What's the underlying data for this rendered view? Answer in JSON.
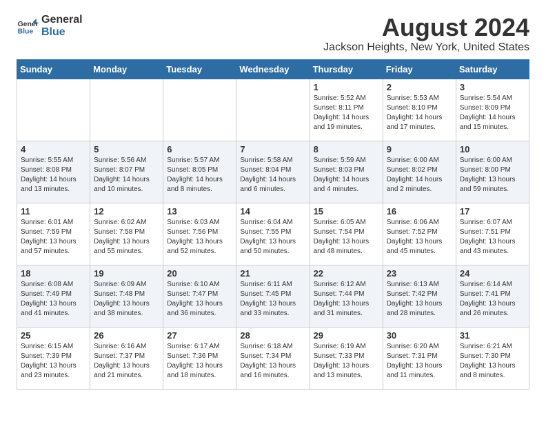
{
  "header": {
    "logo_general": "General",
    "logo_blue": "Blue",
    "month": "August 2024",
    "location": "Jackson Heights, New York, United States"
  },
  "days_of_week": [
    "Sunday",
    "Monday",
    "Tuesday",
    "Wednesday",
    "Thursday",
    "Friday",
    "Saturday"
  ],
  "weeks": [
    [
      {
        "day": "",
        "info": ""
      },
      {
        "day": "",
        "info": ""
      },
      {
        "day": "",
        "info": ""
      },
      {
        "day": "",
        "info": ""
      },
      {
        "day": "1",
        "info": "Sunrise: 5:52 AM\nSunset: 8:11 PM\nDaylight: 14 hours\nand 19 minutes."
      },
      {
        "day": "2",
        "info": "Sunrise: 5:53 AM\nSunset: 8:10 PM\nDaylight: 14 hours\nand 17 minutes."
      },
      {
        "day": "3",
        "info": "Sunrise: 5:54 AM\nSunset: 8:09 PM\nDaylight: 14 hours\nand 15 minutes."
      }
    ],
    [
      {
        "day": "4",
        "info": "Sunrise: 5:55 AM\nSunset: 8:08 PM\nDaylight: 14 hours\nand 13 minutes."
      },
      {
        "day": "5",
        "info": "Sunrise: 5:56 AM\nSunset: 8:07 PM\nDaylight: 14 hours\nand 10 minutes."
      },
      {
        "day": "6",
        "info": "Sunrise: 5:57 AM\nSunset: 8:05 PM\nDaylight: 14 hours\nand 8 minutes."
      },
      {
        "day": "7",
        "info": "Sunrise: 5:58 AM\nSunset: 8:04 PM\nDaylight: 14 hours\nand 6 minutes."
      },
      {
        "day": "8",
        "info": "Sunrise: 5:59 AM\nSunset: 8:03 PM\nDaylight: 14 hours\nand 4 minutes."
      },
      {
        "day": "9",
        "info": "Sunrise: 6:00 AM\nSunset: 8:02 PM\nDaylight: 14 hours\nand 2 minutes."
      },
      {
        "day": "10",
        "info": "Sunrise: 6:00 AM\nSunset: 8:00 PM\nDaylight: 13 hours\nand 59 minutes."
      }
    ],
    [
      {
        "day": "11",
        "info": "Sunrise: 6:01 AM\nSunset: 7:59 PM\nDaylight: 13 hours\nand 57 minutes."
      },
      {
        "day": "12",
        "info": "Sunrise: 6:02 AM\nSunset: 7:58 PM\nDaylight: 13 hours\nand 55 minutes."
      },
      {
        "day": "13",
        "info": "Sunrise: 6:03 AM\nSunset: 7:56 PM\nDaylight: 13 hours\nand 52 minutes."
      },
      {
        "day": "14",
        "info": "Sunrise: 6:04 AM\nSunset: 7:55 PM\nDaylight: 13 hours\nand 50 minutes."
      },
      {
        "day": "15",
        "info": "Sunrise: 6:05 AM\nSunset: 7:54 PM\nDaylight: 13 hours\nand 48 minutes."
      },
      {
        "day": "16",
        "info": "Sunrise: 6:06 AM\nSunset: 7:52 PM\nDaylight: 13 hours\nand 45 minutes."
      },
      {
        "day": "17",
        "info": "Sunrise: 6:07 AM\nSunset: 7:51 PM\nDaylight: 13 hours\nand 43 minutes."
      }
    ],
    [
      {
        "day": "18",
        "info": "Sunrise: 6:08 AM\nSunset: 7:49 PM\nDaylight: 13 hours\nand 41 minutes."
      },
      {
        "day": "19",
        "info": "Sunrise: 6:09 AM\nSunset: 7:48 PM\nDaylight: 13 hours\nand 38 minutes."
      },
      {
        "day": "20",
        "info": "Sunrise: 6:10 AM\nSunset: 7:47 PM\nDaylight: 13 hours\nand 36 minutes."
      },
      {
        "day": "21",
        "info": "Sunrise: 6:11 AM\nSunset: 7:45 PM\nDaylight: 13 hours\nand 33 minutes."
      },
      {
        "day": "22",
        "info": "Sunrise: 6:12 AM\nSunset: 7:44 PM\nDaylight: 13 hours\nand 31 minutes."
      },
      {
        "day": "23",
        "info": "Sunrise: 6:13 AM\nSunset: 7:42 PM\nDaylight: 13 hours\nand 28 minutes."
      },
      {
        "day": "24",
        "info": "Sunrise: 6:14 AM\nSunset: 7:41 PM\nDaylight: 13 hours\nand 26 minutes."
      }
    ],
    [
      {
        "day": "25",
        "info": "Sunrise: 6:15 AM\nSunset: 7:39 PM\nDaylight: 13 hours\nand 23 minutes."
      },
      {
        "day": "26",
        "info": "Sunrise: 6:16 AM\nSunset: 7:37 PM\nDaylight: 13 hours\nand 21 minutes."
      },
      {
        "day": "27",
        "info": "Sunrise: 6:17 AM\nSunset: 7:36 PM\nDaylight: 13 hours\nand 18 minutes."
      },
      {
        "day": "28",
        "info": "Sunrise: 6:18 AM\nSunset: 7:34 PM\nDaylight: 13 hours\nand 16 minutes."
      },
      {
        "day": "29",
        "info": "Sunrise: 6:19 AM\nSunset: 7:33 PM\nDaylight: 13 hours\nand 13 minutes."
      },
      {
        "day": "30",
        "info": "Sunrise: 6:20 AM\nSunset: 7:31 PM\nDaylight: 13 hours\nand 11 minutes."
      },
      {
        "day": "31",
        "info": "Sunrise: 6:21 AM\nSunset: 7:30 PM\nDaylight: 13 hours\nand 8 minutes."
      }
    ]
  ]
}
